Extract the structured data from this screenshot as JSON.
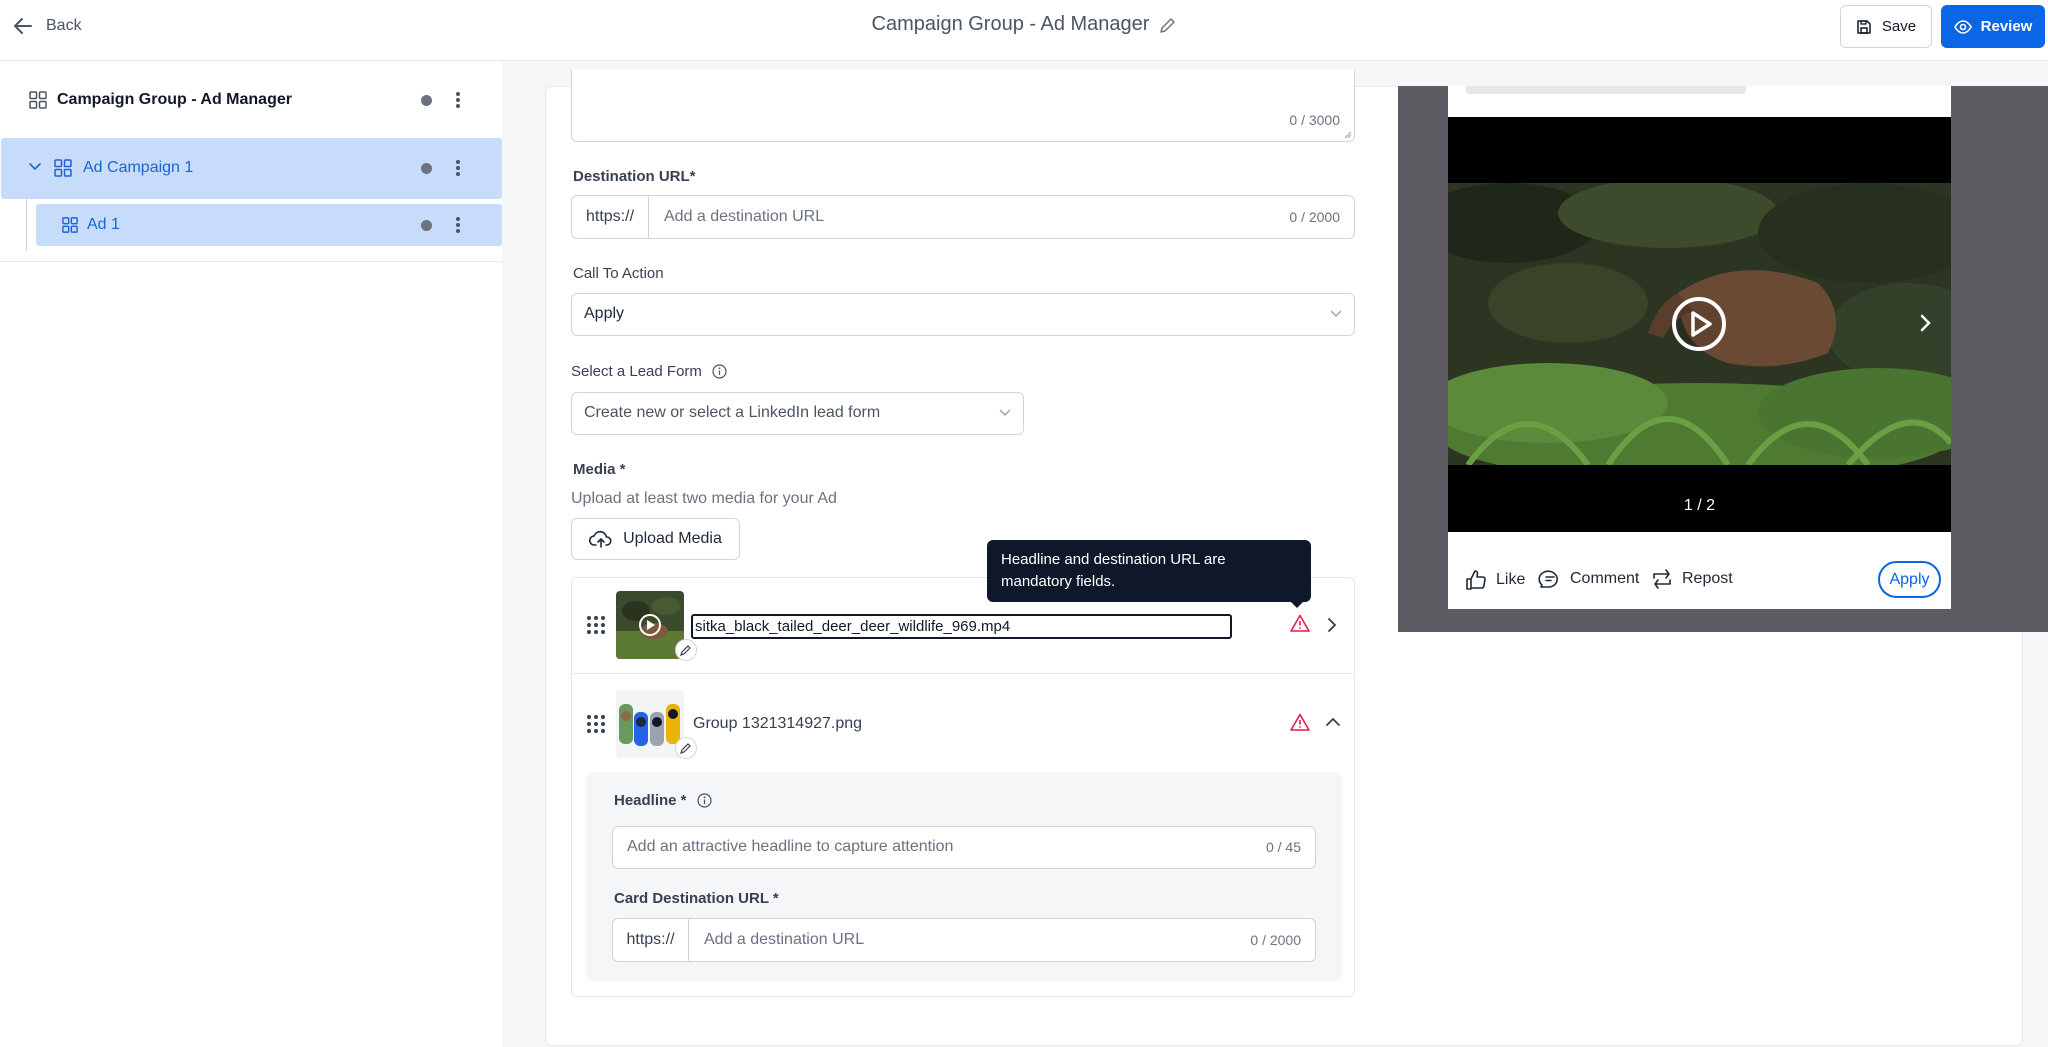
{
  "header": {
    "back_label": "Back",
    "title": "Campaign Group - Ad Manager",
    "save_label": "Save",
    "review_label": "Review"
  },
  "sidebar": {
    "group_label": "Campaign Group - Ad Manager",
    "campaign_label": "Ad Campaign 1",
    "ad_label": "Ad 1"
  },
  "form": {
    "intro_counter": "0 / 3000",
    "destination_url": {
      "label": "Destination URL*",
      "prefix": "https://",
      "placeholder": "Add a destination URL",
      "counter": "0 / 2000"
    },
    "call_to_action": {
      "label": "Call To Action",
      "value": "Apply"
    },
    "lead_form": {
      "label": "Select a Lead Form",
      "placeholder": "Create new or select a LinkedIn lead form"
    },
    "media": {
      "label": "Media *",
      "hint": "Upload at least two media for your Ad",
      "upload_label": "Upload Media",
      "items": [
        {
          "filename": "sitka_black_tailed_deer_deer_wildlife_969.mp4"
        },
        {
          "filename": "Group 1321314927.png"
        }
      ]
    },
    "tooltip": "Headline and destination URL are mandatory fields.",
    "card": {
      "headline_label": "Headline *",
      "headline_placeholder": "Add an attractive headline to capture attention",
      "headline_counter": "0 / 45",
      "url_label": "Card Destination URL *",
      "url_prefix": "https://",
      "url_placeholder": "Add a destination URL",
      "url_counter": "0 / 2000"
    }
  },
  "preview": {
    "slide_counter": "1 / 2",
    "actions": {
      "like": "Like",
      "comment": "Comment",
      "repost": "Repost",
      "apply": "Apply"
    }
  },
  "colors": {
    "accent": "#0a66e4",
    "selected_row": "#c6dcfa",
    "warning": "#e11d48"
  }
}
